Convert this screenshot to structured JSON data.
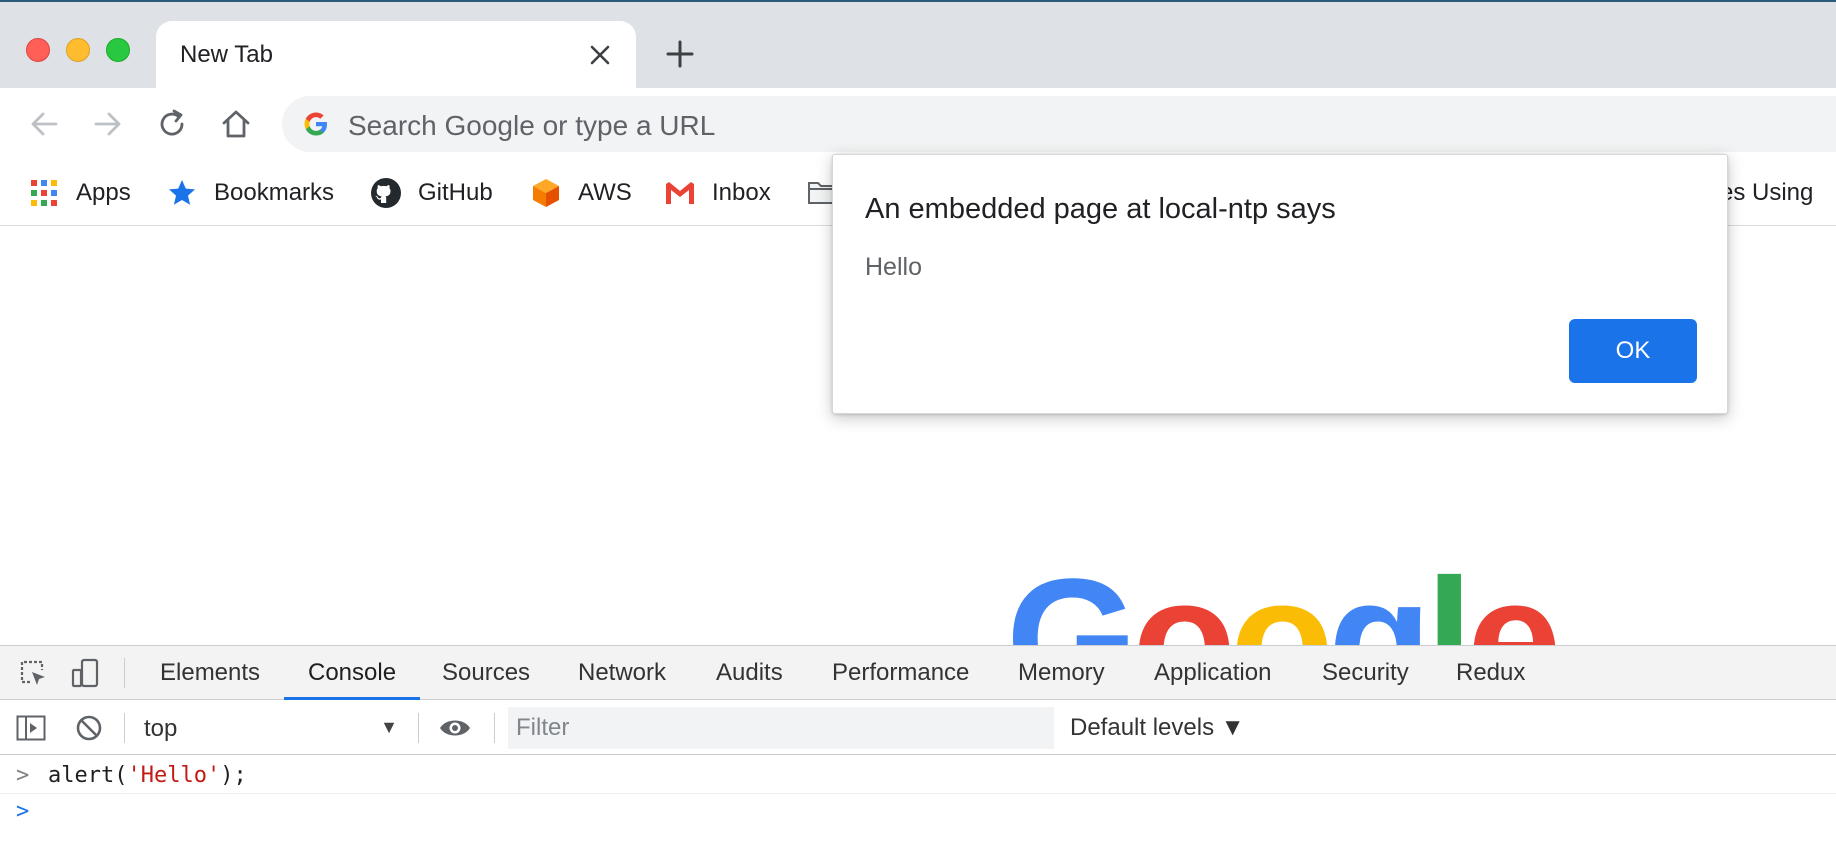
{
  "colors": {
    "accent": "#1a73e8",
    "tab_strip_bg": "#dee1e6",
    "omnibox_bg": "#f1f3f4",
    "string_red": "#c41a16"
  },
  "browser": {
    "tab": {
      "title": "New Tab",
      "close_icon": "close-icon"
    },
    "new_tab_icon": "plus-icon",
    "omnibox": {
      "placeholder": "Search Google or type a URL"
    }
  },
  "bookmarks": {
    "items": [
      {
        "label": "Apps",
        "icon": "apps-grid-icon"
      },
      {
        "label": "Bookmarks",
        "icon": "star-icon"
      },
      {
        "label": "GitHub",
        "icon": "github-icon"
      },
      {
        "label": "AWS",
        "icon": "aws-icon"
      },
      {
        "label": "Inbox",
        "icon": "gmail-icon"
      },
      {
        "label": "",
        "icon": "folder-icon"
      },
      {
        "label": "mes Using",
        "icon": ""
      }
    ]
  },
  "dialog": {
    "title": "An embedded page at local-ntp says",
    "message": "Hello",
    "ok_label": "OK"
  },
  "page": {
    "logo_text": "Google"
  },
  "devtools": {
    "tabs": [
      {
        "label": "Elements",
        "active": false
      },
      {
        "label": "Console",
        "active": true
      },
      {
        "label": "Sources",
        "active": false
      },
      {
        "label": "Network",
        "active": false
      },
      {
        "label": "Audits",
        "active": false
      },
      {
        "label": "Performance",
        "active": false
      },
      {
        "label": "Memory",
        "active": false
      },
      {
        "label": "Application",
        "active": false
      },
      {
        "label": "Security",
        "active": false
      },
      {
        "label": "Redux",
        "active": false
      }
    ],
    "console_bar": {
      "context": "top",
      "filter_placeholder": "Filter",
      "levels": "Default levels ▼"
    },
    "console": {
      "lines": [
        {
          "prompt": ">",
          "code_prefix": "alert(",
          "code_string": "'Hello'",
          "code_suffix": ");"
        },
        {
          "prompt": ">",
          "code_prefix": "",
          "code_string": "",
          "code_suffix": ""
        }
      ]
    }
  }
}
